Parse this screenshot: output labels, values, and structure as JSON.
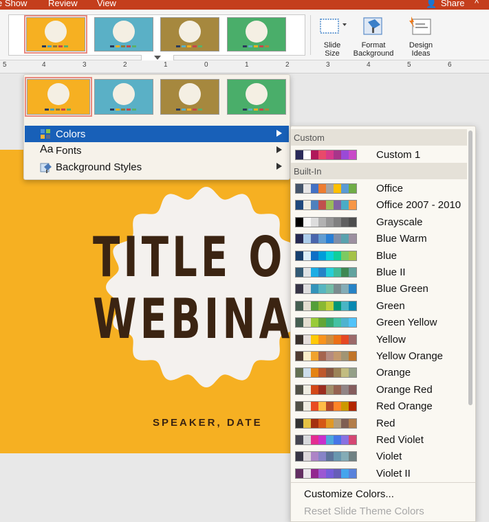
{
  "topbar": {
    "tabs": [
      "e Show",
      "Review",
      "View"
    ],
    "share_label": "Share",
    "collapse_glyph": "^"
  },
  "ribbon": {
    "buttons": [
      {
        "line1": "Slide",
        "line2": "Size",
        "icon": "slide-size-icon"
      },
      {
        "line1": "Format",
        "line2": "Background",
        "icon": "format-background-icon"
      },
      {
        "line1": "Design",
        "line2": "Ideas",
        "icon": "design-ideas-icon"
      }
    ]
  },
  "ruler": {
    "labels": [
      "5",
      "4",
      "3",
      "2",
      "1",
      "0",
      "1",
      "2",
      "3",
      "4",
      "5",
      "6"
    ]
  },
  "variants": [
    {
      "bg": "#f6b022",
      "circle": "#f4efe3",
      "swatches": [
        "#2b3a5a",
        "#4aa0b5",
        "#8a7a3a",
        "#c7464a",
        "#5ab06a"
      ]
    },
    {
      "bg": "#5ab0c6",
      "circle": "#f4efe3",
      "swatches": [
        "#2b3a5a",
        "#f6b022",
        "#8a7a3a",
        "#c7464a",
        "#5ab06a"
      ]
    },
    {
      "bg": "#a6883e",
      "circle": "#f4efe3",
      "swatches": [
        "#2b3a5a",
        "#5ab0c6",
        "#f6b022",
        "#c7464a",
        "#5ab06a"
      ]
    },
    {
      "bg": "#4aae6a",
      "circle": "#f4efe3",
      "swatches": [
        "#2b3a5a",
        "#5ab0c6",
        "#f6b022",
        "#c7464a",
        "#a6883e"
      ]
    }
  ],
  "slide": {
    "title_line1": "TITLE O",
    "title_line2": "WEBINA",
    "speaker": "SPEAKER, DATE"
  },
  "menu": {
    "items": [
      {
        "label": "Colors",
        "icon": "colors-icon",
        "glyph": "▦"
      },
      {
        "label": "Fonts",
        "icon": "fonts-icon",
        "glyph": "Aa"
      },
      {
        "label": "Background Styles",
        "icon": "background-styles-icon",
        "glyph": "▧"
      }
    ]
  },
  "submenu": {
    "custom_header": "Custom",
    "builtin_header": "Built-In",
    "custom": [
      {
        "name": "Custom 1",
        "colors": [
          "#2a2a5a",
          "#ffffff",
          "#b0185a",
          "#e84a6a",
          "#d63a8a",
          "#a8358a",
          "#9a4ad6",
          "#c84ac8"
        ]
      }
    ],
    "builtin": [
      {
        "name": "Office",
        "colors": [
          "#44546a",
          "#e7e6e6",
          "#4472c4",
          "#ed7d31",
          "#a5a5a5",
          "#ffc000",
          "#5b9bd5",
          "#70ad47"
        ]
      },
      {
        "name": "Office 2007 - 2010",
        "colors": [
          "#1f497d",
          "#eeece1",
          "#4f81bd",
          "#c0504d",
          "#9bbb59",
          "#8064a2",
          "#4bacc6",
          "#f79646"
        ]
      },
      {
        "name": "Grayscale",
        "colors": [
          "#000000",
          "#f8f8f8",
          "#dddddd",
          "#b2b2b2",
          "#969696",
          "#808080",
          "#5f5f5f",
          "#4d4d4d"
        ]
      },
      {
        "name": "Blue Warm",
        "colors": [
          "#242852",
          "#acccea",
          "#4a66ac",
          "#629dd1",
          "#297fd5",
          "#7f8fa9",
          "#5aa2ae",
          "#9d90a0"
        ]
      },
      {
        "name": "Blue",
        "colors": [
          "#17406d",
          "#dbeff9",
          "#0f6fc6",
          "#009dd9",
          "#0bd0d9",
          "#10cf9b",
          "#7cca62",
          "#a5c249"
        ]
      },
      {
        "name": "Blue II",
        "colors": [
          "#335b74",
          "#dfe3e5",
          "#1cade4",
          "#2683c6",
          "#27ced7",
          "#42ba97",
          "#3e8853",
          "#62a39f"
        ]
      },
      {
        "name": "Blue Green",
        "colors": [
          "#373545",
          "#dedede",
          "#3494ba",
          "#58b6c0",
          "#75bda7",
          "#7a8c8e",
          "#84acb6",
          "#2683c6"
        ]
      },
      {
        "name": "Green",
        "colors": [
          "#455f51",
          "#e3ded1",
          "#549e39",
          "#8ab833",
          "#c0cf3a",
          "#029676",
          "#4ab5c4",
          "#0989b1"
        ]
      },
      {
        "name": "Green Yellow",
        "colors": [
          "#455f51",
          "#e3ded1",
          "#99cb38",
          "#63a537",
          "#37a76f",
          "#44c1a3",
          "#4eb3cf",
          "#51c3f9"
        ]
      },
      {
        "name": "Yellow",
        "colors": [
          "#39302a",
          "#e5dedb",
          "#ffca08",
          "#f8931d",
          "#ce8d3e",
          "#ec7016",
          "#e64823",
          "#9c6a6a"
        ]
      },
      {
        "name": "Yellow Orange",
        "colors": [
          "#4e3b30",
          "#fbeec9",
          "#f0a22e",
          "#a5644e",
          "#b58b80",
          "#c3986d",
          "#a19574",
          "#c17529"
        ]
      },
      {
        "name": "Orange",
        "colors": [
          "#637052",
          "#ccddea",
          "#e48312",
          "#bd582c",
          "#865640",
          "#9b8357",
          "#c2bc80",
          "#94a088"
        ]
      },
      {
        "name": "Orange Red",
        "colors": [
          "#505046",
          "#eeece1",
          "#d34817",
          "#9b2d1f",
          "#a28e6a",
          "#956251",
          "#918485",
          "#855d5d"
        ]
      },
      {
        "name": "Red Orange",
        "colors": [
          "#505046",
          "#eeece1",
          "#e84c22",
          "#ffbd47",
          "#b64926",
          "#ff8427",
          "#cc9900",
          "#b22600"
        ]
      },
      {
        "name": "Red",
        "colors": [
          "#323232",
          "#e5c243",
          "#a5300f",
          "#d55816",
          "#e19825",
          "#b19c7d",
          "#7f5f52",
          "#b27d49"
        ]
      },
      {
        "name": "Red Violet",
        "colors": [
          "#454551",
          "#d8d9dc",
          "#e32d91",
          "#c830cc",
          "#4ea6dc",
          "#4775e7",
          "#8971e1",
          "#d54773"
        ]
      },
      {
        "name": "Violet",
        "colors": [
          "#373545",
          "#dcd8dc",
          "#ad84c6",
          "#8784c7",
          "#5d739a",
          "#6997af",
          "#84acb6",
          "#6f8183"
        ]
      },
      {
        "name": "Violet II",
        "colors": [
          "#632e62",
          "#eae5eb",
          "#92278f",
          "#9b57d3",
          "#755dd9",
          "#665eb8",
          "#45a5ed",
          "#5982db"
        ]
      }
    ],
    "customize_label": "Customize Colors...",
    "reset_label": "Reset Slide Theme Colors"
  }
}
